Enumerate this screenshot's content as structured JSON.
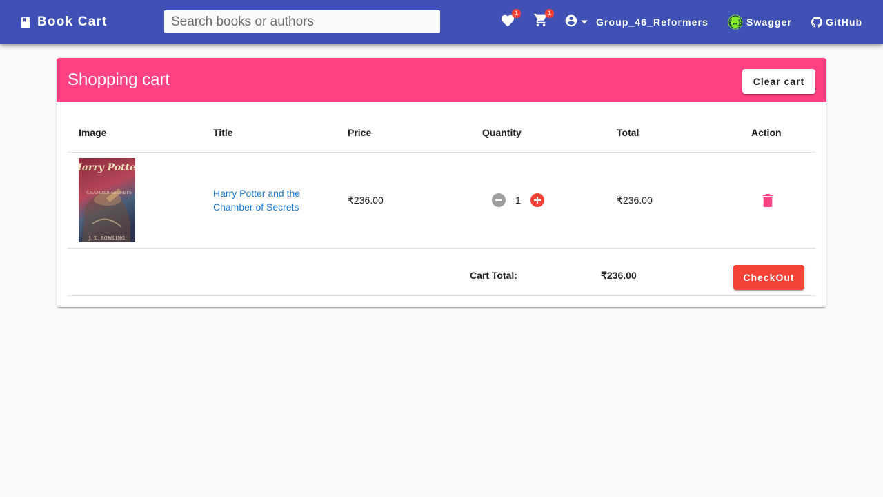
{
  "colors": {
    "toolbar": "#3f51b5",
    "card_header": "#ff4081",
    "link": "#1976d2",
    "danger": "#f44336",
    "swagger_logo": "#85ea2d"
  },
  "header": {
    "brand_icon": "book-icon",
    "brand": "Book Cart",
    "search_placeholder": "Search books or authors",
    "wishlist_icon": "heart-icon",
    "wishlist_count": "1",
    "cart_icon": "cart-icon",
    "cart_count": "1",
    "user_icon": "account-circle-icon",
    "user_name": "Group_46_Reformers",
    "swagger_label": "Swagger",
    "github_label": "GitHub"
  },
  "cart": {
    "title": "Shopping cart",
    "clear_label": "Clear cart",
    "columns": [
      "Image",
      "Title",
      "Price",
      "Quantity",
      "Total",
      "Action"
    ],
    "items": [
      {
        "cover_title": "Harry Potter",
        "cover_subtitle": "CHAMBER SECRETS",
        "cover_author": "J. K. ROWLING",
        "title": "Harry Potter and the Chamber of Secrets",
        "price": "₹236.00",
        "quantity": "1",
        "total": "₹236.00"
      }
    ],
    "total_label": "Cart Total:",
    "total_value": "₹236.00",
    "checkout_label": "CheckOut"
  }
}
